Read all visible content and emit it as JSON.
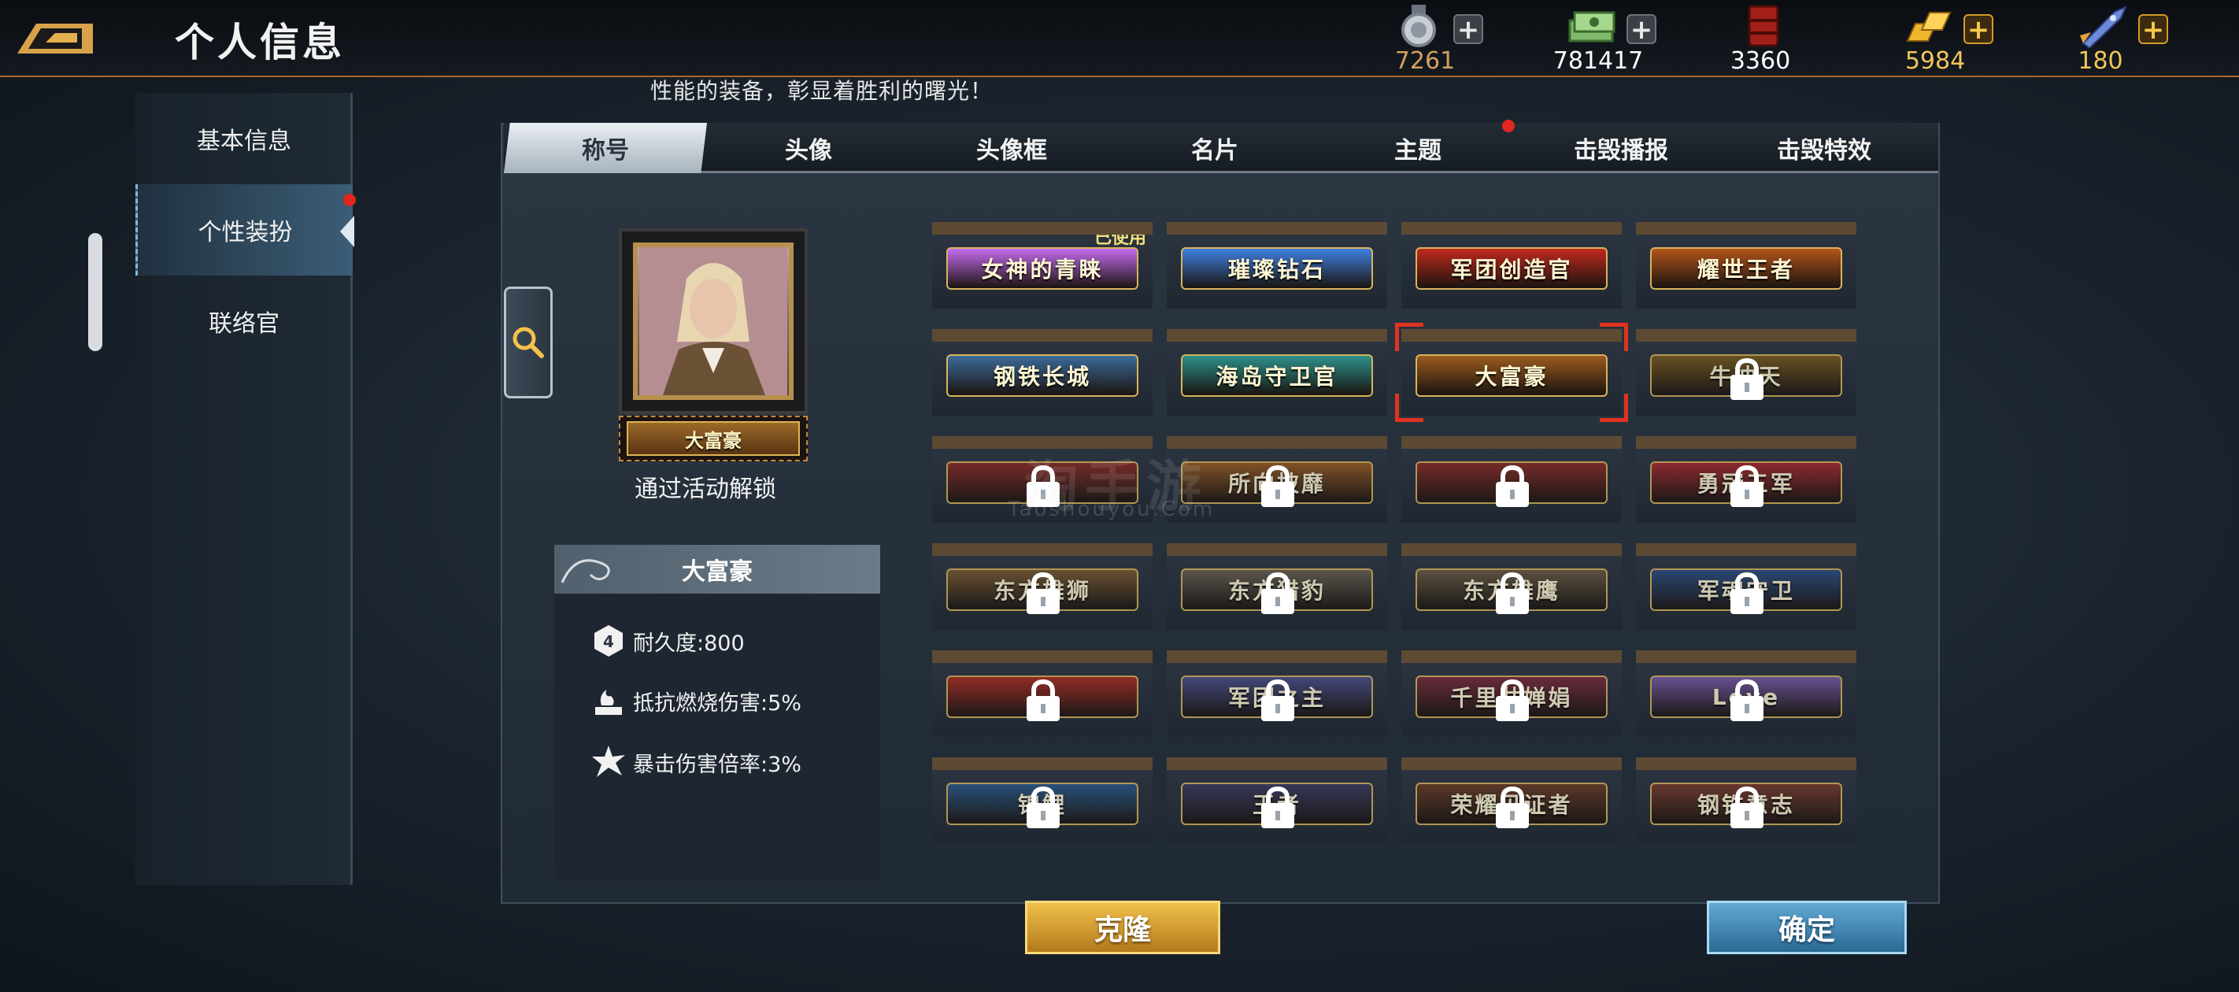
{
  "header": {
    "title": "个人信息",
    "currencies": [
      {
        "icon": "silver-medal-icon",
        "value": "7261",
        "value_color": "#d4a15e",
        "plus": "grey"
      },
      {
        "icon": "cash-stack-icon",
        "value": "781417",
        "value_color": "#f0f0f0",
        "plus": "grey"
      },
      {
        "icon": "fuel-barrel-icon",
        "value": "3360",
        "value_color": "#f0f0f0",
        "plus": "none"
      },
      {
        "icon": "gold-bars-icon",
        "value": "5984",
        "value_color": "#f3c55a",
        "plus": "gold"
      },
      {
        "icon": "rocket-icon",
        "value": "180",
        "value_color": "#f3c55a",
        "plus": "gold"
      }
    ]
  },
  "caption": "性能的装备，彰显着胜利的曙光！",
  "sidebar": {
    "items": [
      {
        "label": "基本信息",
        "active": false
      },
      {
        "label": "个性装扮",
        "active": true
      },
      {
        "label": "联络官",
        "active": false
      }
    ]
  },
  "tabs": [
    "称号",
    "头像",
    "头像框",
    "名片",
    "主题",
    "击毁播报",
    "击毁特效"
  ],
  "active_tab": "称号",
  "preview": {
    "title_badge": "大富豪",
    "unlock_hint": "通过活动解锁"
  },
  "stats": {
    "title": "大富豪",
    "items": [
      {
        "icon": "durability-icon",
        "label": "耐久度:800"
      },
      {
        "icon": "fire-resist-icon",
        "label": "抵抗燃烧伤害:5%"
      },
      {
        "icon": "critical-icon",
        "label": "暴击伤害倍率:3%"
      }
    ]
  },
  "titles": [
    {
      "text": "女神的青睐",
      "locked": false,
      "used": true,
      "selected": false,
      "color": "#c46bf0"
    },
    {
      "text": "璀璨钻石",
      "locked": false,
      "used": false,
      "selected": false,
      "color": "#3f7fe0"
    },
    {
      "text": "军团创造官",
      "locked": false,
      "used": false,
      "selected": false,
      "color": "#c0291c"
    },
    {
      "text": "耀世王者",
      "locked": false,
      "used": false,
      "selected": false,
      "color": "#b3541b"
    },
    {
      "text": "钢铁长城",
      "locked": false,
      "used": false,
      "selected": false,
      "color": "#3c6a9a"
    },
    {
      "text": "海岛守卫官",
      "locked": false,
      "used": false,
      "selected": false,
      "color": "#2d8f8a"
    },
    {
      "text": "大富豪",
      "locked": false,
      "used": false,
      "selected": true,
      "color": "#9b5a1e"
    },
    {
      "text": "牛冲天",
      "locked": true,
      "used": false,
      "selected": false,
      "color": "#7a5a1c"
    },
    {
      "text": "",
      "locked": true,
      "used": false,
      "selected": false,
      "color": "#8a2a22"
    },
    {
      "text": "所向披靡",
      "locked": true,
      "used": false,
      "selected": false,
      "color": "#9a5a22"
    },
    {
      "text": "",
      "locked": true,
      "used": false,
      "selected": false,
      "color": "#8a2a22"
    },
    {
      "text": "勇冠三军",
      "locked": true,
      "used": false,
      "selected": false,
      "color": "#a8282a"
    },
    {
      "text": "东方雄狮",
      "locked": true,
      "used": false,
      "selected": false,
      "color": "#7a5a30"
    },
    {
      "text": "东方猎豹",
      "locked": true,
      "used": false,
      "selected": false,
      "color": "#6a6050"
    },
    {
      "text": "东方雄鹰",
      "locked": true,
      "used": false,
      "selected": false,
      "color": "#6a5a40"
    },
    {
      "text": "军魂守卫",
      "locked": true,
      "used": false,
      "selected": false,
      "color": "#2c4e82"
    },
    {
      "text": "",
      "locked": true,
      "used": false,
      "selected": false,
      "color": "#b02a1e"
    },
    {
      "text": "军团之主",
      "locked": true,
      "used": false,
      "selected": false,
      "color": "#4a4e8a"
    },
    {
      "text": "千里共婵娟",
      "locked": true,
      "used": false,
      "selected": false,
      "color": "#7a2a3a"
    },
    {
      "text": "Love",
      "locked": true,
      "used": false,
      "selected": false,
      "color": "#7a5aa8"
    },
    {
      "text": "锦鲤",
      "locked": true,
      "used": false,
      "selected": false,
      "color": "#2a5a8a"
    },
    {
      "text": "王者",
      "locked": true,
      "used": false,
      "selected": false,
      "color": "#3a3a60"
    },
    {
      "text": "荣耀见证者",
      "locked": true,
      "used": false,
      "selected": false,
      "color": "#6a3a22"
    },
    {
      "text": "钢铁意志",
      "locked": true,
      "used": false,
      "selected": false,
      "color": "#7a3a28"
    }
  ],
  "used_label": "已使用",
  "watermark": {
    "big": "淘手游",
    "small": "Taoshouyou.Com"
  },
  "buttons": {
    "clone": "克隆",
    "confirm": "确定"
  }
}
